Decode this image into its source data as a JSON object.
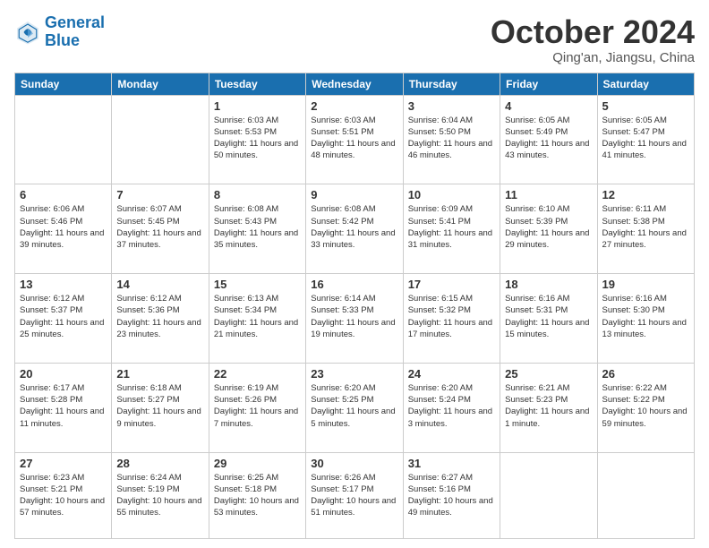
{
  "logo": {
    "text_general": "General",
    "text_blue": "Blue"
  },
  "header": {
    "title": "October 2024",
    "subtitle": "Qing'an, Jiangsu, China"
  },
  "weekdays": [
    "Sunday",
    "Monday",
    "Tuesday",
    "Wednesday",
    "Thursday",
    "Friday",
    "Saturday"
  ],
  "weeks": [
    [
      {
        "num": "",
        "info": ""
      },
      {
        "num": "",
        "info": ""
      },
      {
        "num": "1",
        "info": "Sunrise: 6:03 AM\nSunset: 5:53 PM\nDaylight: 11 hours and 50 minutes."
      },
      {
        "num": "2",
        "info": "Sunrise: 6:03 AM\nSunset: 5:51 PM\nDaylight: 11 hours and 48 minutes."
      },
      {
        "num": "3",
        "info": "Sunrise: 6:04 AM\nSunset: 5:50 PM\nDaylight: 11 hours and 46 minutes."
      },
      {
        "num": "4",
        "info": "Sunrise: 6:05 AM\nSunset: 5:49 PM\nDaylight: 11 hours and 43 minutes."
      },
      {
        "num": "5",
        "info": "Sunrise: 6:05 AM\nSunset: 5:47 PM\nDaylight: 11 hours and 41 minutes."
      }
    ],
    [
      {
        "num": "6",
        "info": "Sunrise: 6:06 AM\nSunset: 5:46 PM\nDaylight: 11 hours and 39 minutes."
      },
      {
        "num": "7",
        "info": "Sunrise: 6:07 AM\nSunset: 5:45 PM\nDaylight: 11 hours and 37 minutes."
      },
      {
        "num": "8",
        "info": "Sunrise: 6:08 AM\nSunset: 5:43 PM\nDaylight: 11 hours and 35 minutes."
      },
      {
        "num": "9",
        "info": "Sunrise: 6:08 AM\nSunset: 5:42 PM\nDaylight: 11 hours and 33 minutes."
      },
      {
        "num": "10",
        "info": "Sunrise: 6:09 AM\nSunset: 5:41 PM\nDaylight: 11 hours and 31 minutes."
      },
      {
        "num": "11",
        "info": "Sunrise: 6:10 AM\nSunset: 5:39 PM\nDaylight: 11 hours and 29 minutes."
      },
      {
        "num": "12",
        "info": "Sunrise: 6:11 AM\nSunset: 5:38 PM\nDaylight: 11 hours and 27 minutes."
      }
    ],
    [
      {
        "num": "13",
        "info": "Sunrise: 6:12 AM\nSunset: 5:37 PM\nDaylight: 11 hours and 25 minutes."
      },
      {
        "num": "14",
        "info": "Sunrise: 6:12 AM\nSunset: 5:36 PM\nDaylight: 11 hours and 23 minutes."
      },
      {
        "num": "15",
        "info": "Sunrise: 6:13 AM\nSunset: 5:34 PM\nDaylight: 11 hours and 21 minutes."
      },
      {
        "num": "16",
        "info": "Sunrise: 6:14 AM\nSunset: 5:33 PM\nDaylight: 11 hours and 19 minutes."
      },
      {
        "num": "17",
        "info": "Sunrise: 6:15 AM\nSunset: 5:32 PM\nDaylight: 11 hours and 17 minutes."
      },
      {
        "num": "18",
        "info": "Sunrise: 6:16 AM\nSunset: 5:31 PM\nDaylight: 11 hours and 15 minutes."
      },
      {
        "num": "19",
        "info": "Sunrise: 6:16 AM\nSunset: 5:30 PM\nDaylight: 11 hours and 13 minutes."
      }
    ],
    [
      {
        "num": "20",
        "info": "Sunrise: 6:17 AM\nSunset: 5:28 PM\nDaylight: 11 hours and 11 minutes."
      },
      {
        "num": "21",
        "info": "Sunrise: 6:18 AM\nSunset: 5:27 PM\nDaylight: 11 hours and 9 minutes."
      },
      {
        "num": "22",
        "info": "Sunrise: 6:19 AM\nSunset: 5:26 PM\nDaylight: 11 hours and 7 minutes."
      },
      {
        "num": "23",
        "info": "Sunrise: 6:20 AM\nSunset: 5:25 PM\nDaylight: 11 hours and 5 minutes."
      },
      {
        "num": "24",
        "info": "Sunrise: 6:20 AM\nSunset: 5:24 PM\nDaylight: 11 hours and 3 minutes."
      },
      {
        "num": "25",
        "info": "Sunrise: 6:21 AM\nSunset: 5:23 PM\nDaylight: 11 hours and 1 minute."
      },
      {
        "num": "26",
        "info": "Sunrise: 6:22 AM\nSunset: 5:22 PM\nDaylight: 10 hours and 59 minutes."
      }
    ],
    [
      {
        "num": "27",
        "info": "Sunrise: 6:23 AM\nSunset: 5:21 PM\nDaylight: 10 hours and 57 minutes."
      },
      {
        "num": "28",
        "info": "Sunrise: 6:24 AM\nSunset: 5:19 PM\nDaylight: 10 hours and 55 minutes."
      },
      {
        "num": "29",
        "info": "Sunrise: 6:25 AM\nSunset: 5:18 PM\nDaylight: 10 hours and 53 minutes."
      },
      {
        "num": "30",
        "info": "Sunrise: 6:26 AM\nSunset: 5:17 PM\nDaylight: 10 hours and 51 minutes."
      },
      {
        "num": "31",
        "info": "Sunrise: 6:27 AM\nSunset: 5:16 PM\nDaylight: 10 hours and 49 minutes."
      },
      {
        "num": "",
        "info": ""
      },
      {
        "num": "",
        "info": ""
      }
    ]
  ]
}
